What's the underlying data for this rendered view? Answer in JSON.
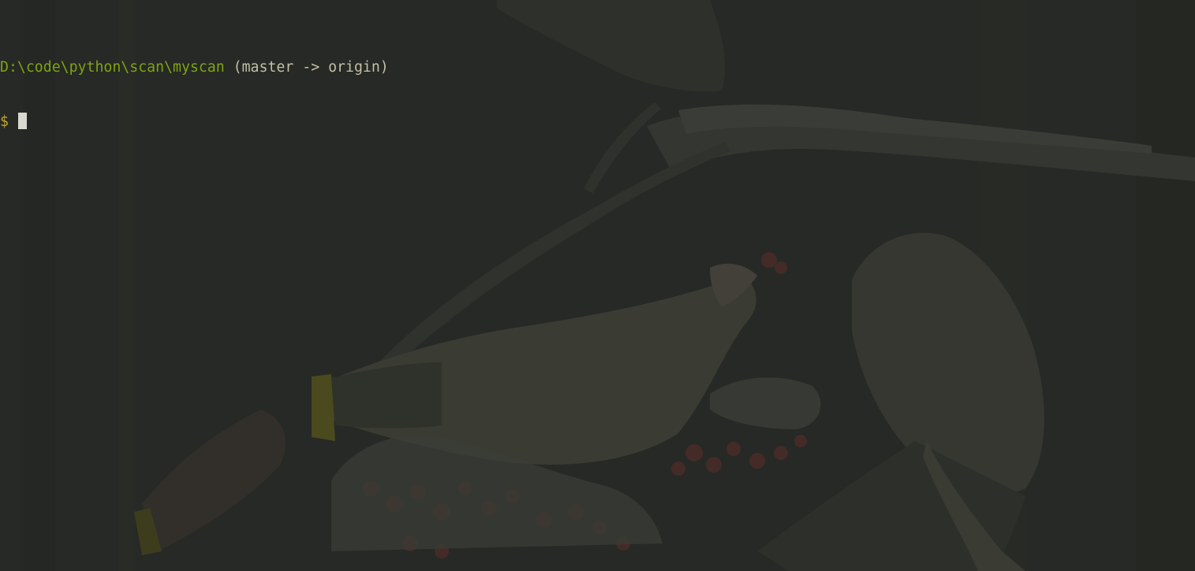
{
  "terminal": {
    "cwd": "D:\\code\\python\\scan\\myscan",
    "branch_info": " (master -> origin)",
    "prompt_symbol": "$",
    "input_text": ""
  },
  "background": {
    "description_icon": "waxwing-birds-wallpaper-icon"
  },
  "colors": {
    "background": "#262925",
    "path": "#7fa311",
    "branch": "#c2c0a4",
    "prompt": "#c2a62c",
    "cursor": "#d8d8d0"
  }
}
